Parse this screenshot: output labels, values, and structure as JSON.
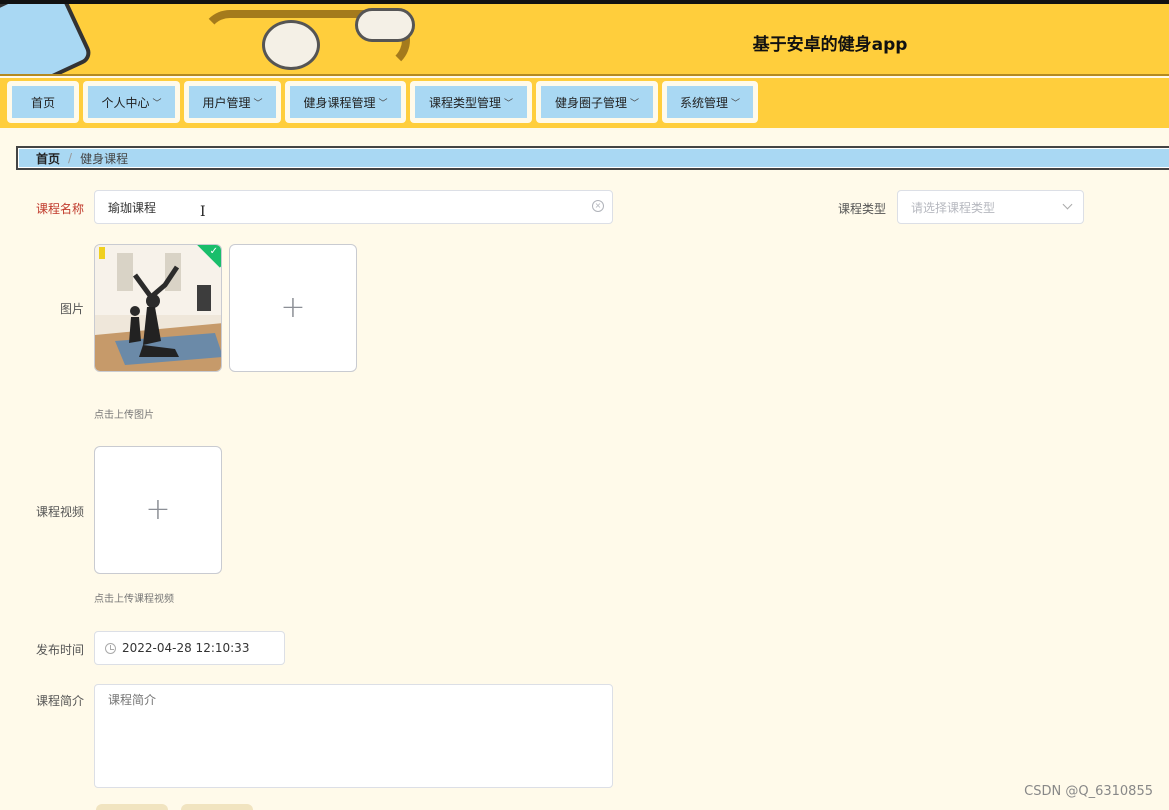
{
  "header": {
    "title": "基于安卓的健身app"
  },
  "nav": [
    {
      "label": "首页",
      "dropdown": false
    },
    {
      "label": "个人中心",
      "dropdown": true
    },
    {
      "label": "用户管理",
      "dropdown": true
    },
    {
      "label": "健身课程管理",
      "dropdown": true
    },
    {
      "label": "课程类型管理",
      "dropdown": true
    },
    {
      "label": "健身圈子管理",
      "dropdown": true
    },
    {
      "label": "系统管理",
      "dropdown": true
    }
  ],
  "breadcrumb": {
    "home": "首页",
    "separator": "/",
    "current": "健身课程"
  },
  "form": {
    "course_name_label": "课程名称",
    "course_name_value": "瑜珈课程",
    "course_type_label": "课程类型",
    "course_type_placeholder": "请选择课程类型",
    "image_label": "图片",
    "image_hint": "点击上传图片",
    "video_label": "课程视频",
    "video_hint": "点击上传课程视频",
    "publish_time_label": "发布时间",
    "publish_time_value": "2022-04-28 12:10:33",
    "intro_label": "课程简介",
    "intro_placeholder": "课程简介"
  },
  "icons": {
    "clear": "circle-x-icon",
    "chevron": "chevron-down-icon",
    "plus": "plus-icon",
    "clock": "clock-icon",
    "check": "check-icon",
    "text_cursor": "text-cursor-icon"
  },
  "watermark": "CSDN @Q_6310855",
  "colors": {
    "header_bg": "#ffce3c",
    "nav_item_bg": "#a9d8f3",
    "page_bg": "#fffaea",
    "required_label": "#c0392b",
    "success": "#19be6b"
  }
}
